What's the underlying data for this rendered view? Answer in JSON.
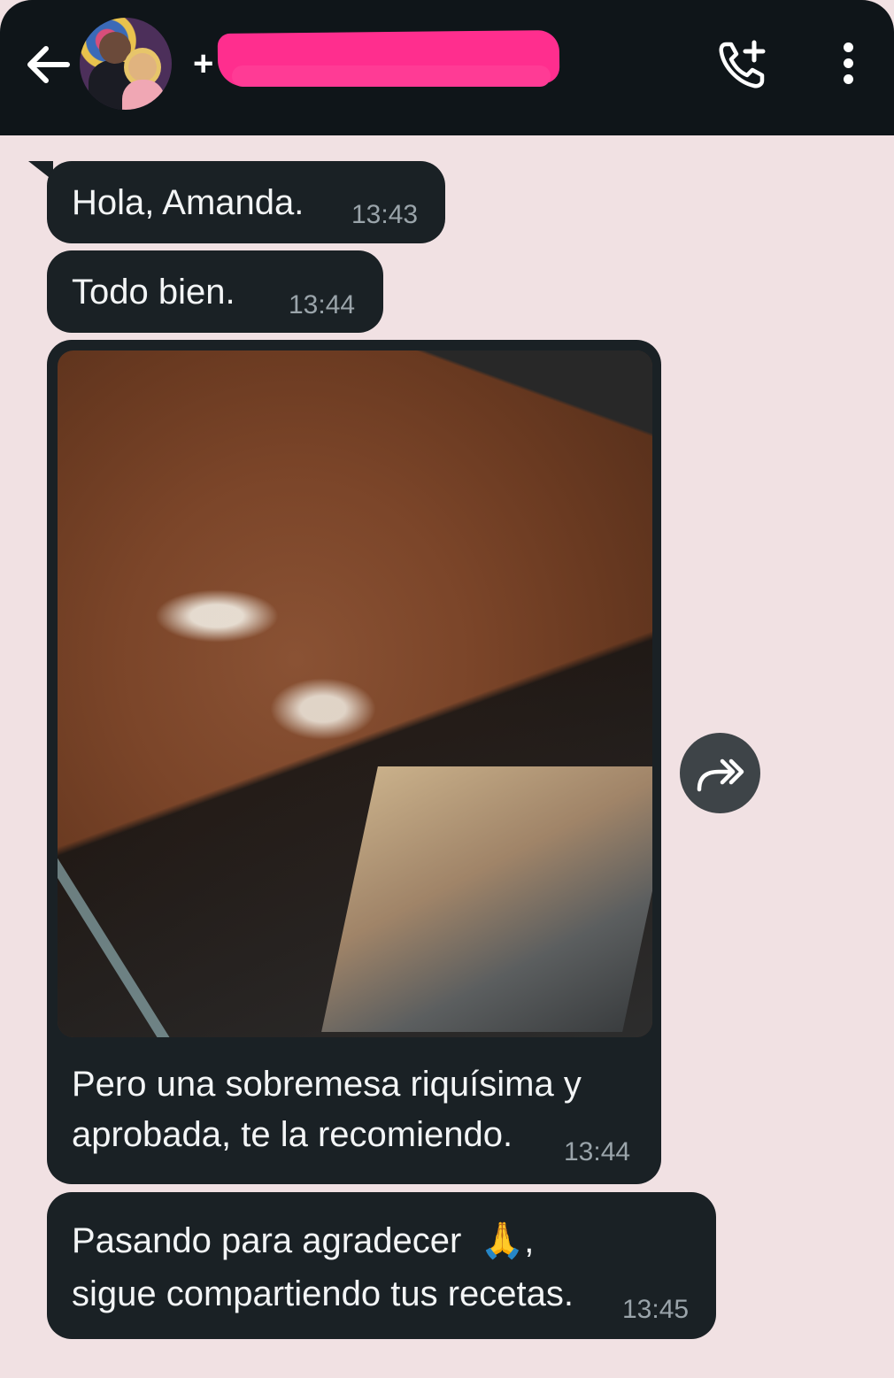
{
  "header": {
    "back_icon": "arrow-left-icon",
    "contact_name": "+",
    "call_icon": "phone-plus-icon",
    "menu_icon": "more-vertical-icon"
  },
  "messages": [
    {
      "text": "Hola, Amanda.",
      "time": "13:43"
    },
    {
      "text": "Todo bien.",
      "time": "13:44"
    },
    {
      "caption_line1": "Pero una sobremesa riquísima y",
      "caption_line2": "aprobada, te la recomiendo.",
      "time": "13:44"
    },
    {
      "line1": "Pasando para agradecer",
      "emoji": "🙏",
      "comma": ",",
      "line2": "sigue compartiendo tus recetas.",
      "time": "13:45"
    }
  ],
  "forward_icon": "forward-icon",
  "colors": {
    "header_bg": "#0f1519",
    "chat_bg": "#f1e1e3",
    "bubble_bg": "#1a2125",
    "time_text": "#9aa4aa",
    "redaction": "#ff2e8e"
  }
}
